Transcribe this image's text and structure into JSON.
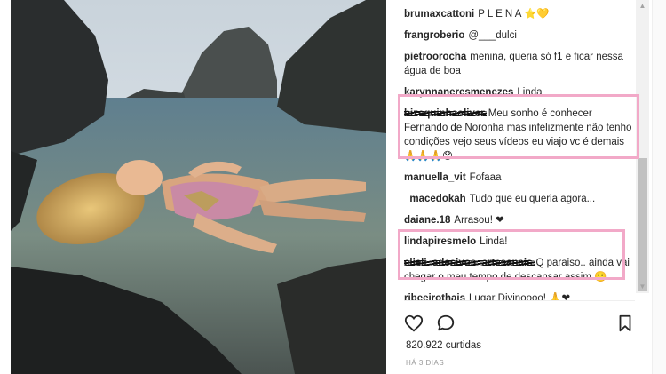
{
  "post": {
    "likes_text": "820.922 curtidas",
    "time_text": "HÁ 3 DIAS"
  },
  "comments": [
    {
      "user": "brumaxcattoni",
      "text": "P L E N A ⭐💛"
    },
    {
      "user": "frangroberio",
      "text": "@___dulci"
    },
    {
      "user": "pietroorocha",
      "text": "menina, queria só f1 e ficar nessa água de boa"
    },
    {
      "user": "karynnaneresmenezes",
      "text": "Linda"
    },
    {
      "user": "bizequinhaoliver",
      "text": "Meu sonho é conhecer Fernando de Noronha mas infelizmente não tenho condições vejo seus vídeos eu viajo vc é demais 🙏🙏🙏😯"
    },
    {
      "user": "manuella_vit",
      "text": "Fofaaa"
    },
    {
      "user": "_macedokah",
      "text": "Tudo que eu queria agora..."
    },
    {
      "user": "daiane.18",
      "text": "Arrasou! ❤"
    },
    {
      "user": "lindapiresmelo",
      "text": "Linda!"
    },
    {
      "user": "elieli_adesivos_artesanais",
      "text": "Q paraiso.. ainda vai chegar o meu tempo de descansar assim 🙂"
    },
    {
      "user": "ribeeirothais",
      "text": "Lugar Divinoooo! 🙏❤"
    }
  ],
  "icons": {
    "like": "heart-outline",
    "comment": "speech-bubble",
    "save": "bookmark",
    "scroll_up": "▲",
    "scroll_down": "▼"
  },
  "colors": {
    "highlight": "#f2a9c8",
    "text": "#262626",
    "muted": "#999999"
  }
}
